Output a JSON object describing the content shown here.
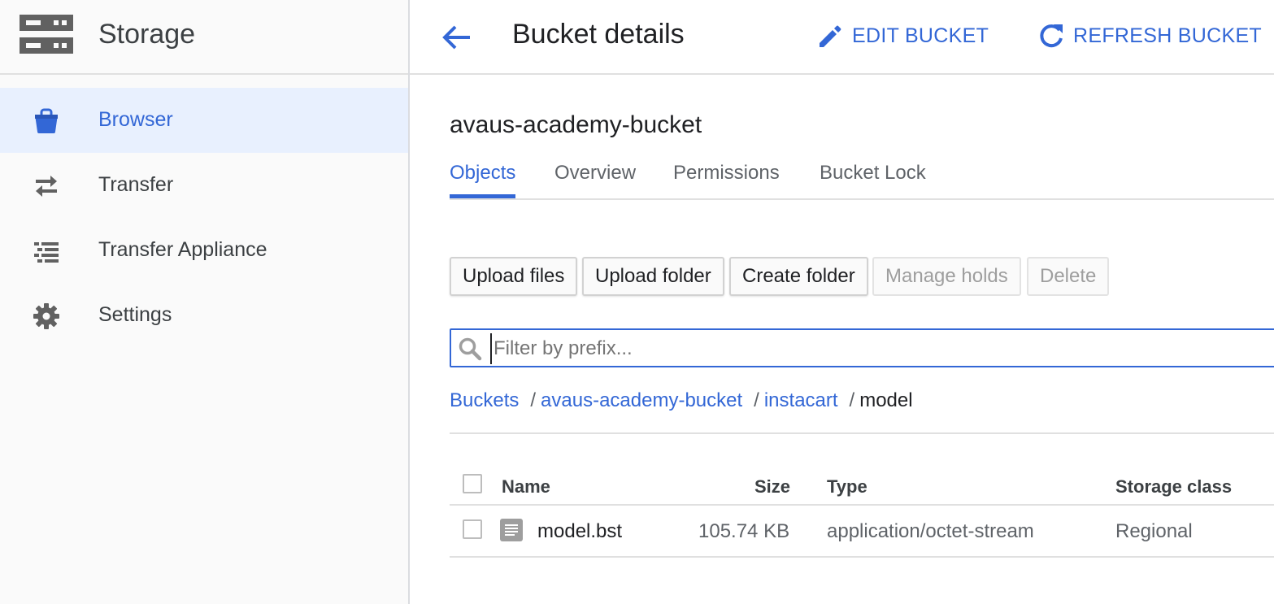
{
  "sidebar": {
    "product_icon": "storage-icon",
    "title": "Storage",
    "items": [
      {
        "label": "Browser",
        "icon": "bucket-icon",
        "active": true
      },
      {
        "label": "Transfer",
        "icon": "swap-arrows-icon",
        "active": false
      },
      {
        "label": "Transfer Appliance",
        "icon": "list-icon",
        "active": false
      },
      {
        "label": "Settings",
        "icon": "gear-icon",
        "active": false
      }
    ]
  },
  "header": {
    "back_icon": "arrow-back-icon",
    "title": "Bucket details",
    "edit_label": "EDIT BUCKET",
    "edit_icon": "pencil-icon",
    "refresh_label": "REFRESH BUCKET",
    "refresh_icon": "refresh-icon"
  },
  "bucket": {
    "name": "avaus-academy-bucket"
  },
  "tabs": [
    {
      "label": "Objects",
      "active": true
    },
    {
      "label": "Overview",
      "active": false
    },
    {
      "label": "Permissions",
      "active": false
    },
    {
      "label": "Bucket Lock",
      "active": false
    }
  ],
  "toolbar": {
    "upload_files": "Upload files",
    "upload_folder": "Upload folder",
    "create_folder": "Create folder",
    "manage_holds": "Manage holds",
    "delete": "Delete"
  },
  "filter": {
    "placeholder": "Filter by prefix...",
    "value": ""
  },
  "breadcrumb": {
    "items": [
      "Buckets",
      "avaus-academy-bucket",
      "instacart"
    ],
    "separator": "/",
    "current": "model"
  },
  "table": {
    "columns": [
      "Name",
      "Size",
      "Type",
      "Storage class"
    ],
    "rows": [
      {
        "name": "model.bst",
        "size": "105.74 KB",
        "type": "application/octet-stream",
        "storage_class": "Regional"
      }
    ]
  },
  "colors": {
    "accent": "#3367d6",
    "active_nav_bg": "#e8f0fe",
    "sidebar_bg": "#fafafa",
    "icon_grey": "#616161"
  }
}
